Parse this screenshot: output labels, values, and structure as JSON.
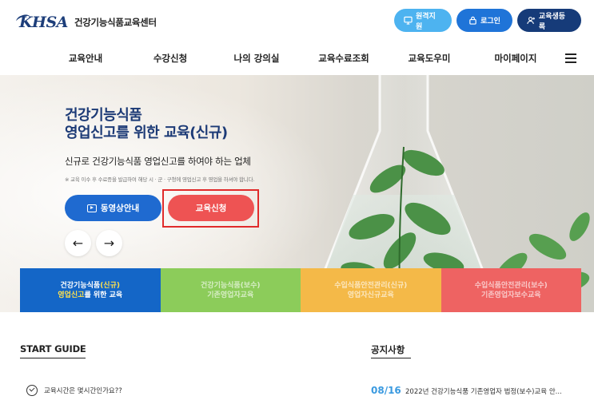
{
  "header": {
    "logo_mark": "KHSA",
    "logo_text": "건강기능식품교육센터",
    "buttons": [
      {
        "label": "원격지원",
        "icon": "monitor-icon"
      },
      {
        "label": "로그인",
        "icon": "lock-icon"
      },
      {
        "label": "교육생등록",
        "icon": "user-add-icon"
      }
    ]
  },
  "nav": {
    "items": [
      "교육안내",
      "수강신청",
      "나의 강의실",
      "교육수료조회",
      "교육도우미",
      "마이페이지"
    ],
    "menu_icon": "hamburger-icon"
  },
  "hero": {
    "title_line1": "건강기능식품",
    "title_line2": "영업신고를 위한 교육(신규)",
    "subtitle": "신규로 건강기능식품 영업신고를 하여야 하는 업체",
    "note": "※ 교육 이수 후 수료증을 발급하여 해당 시 · 군 · 구청에 영업신고 후 영업을 하셔야 합니다.",
    "video_button": "동영상안내",
    "apply_button": "교육신청",
    "prev_arrow": "←",
    "next_arrow": "→"
  },
  "tabs": [
    {
      "line1_pre": "건강기능식품",
      "line1_hl": "(신규)",
      "line2_hl": "영업신고",
      "line2_post": "를 위한 교육"
    },
    {
      "line1": "건강기능식품(보수)",
      "line2": "기존영업자교육"
    },
    {
      "line1": "수입식품안전관리(신규)",
      "line2": "영업자신규교육"
    },
    {
      "line1": "수입식품안전관리(보수)",
      "line2": "기존영업자보수교육"
    }
  ],
  "start_guide": {
    "title": "START GUIDE",
    "item": "교육시간은 몇시간인가요??"
  },
  "notice": {
    "title": "공지사항",
    "date": "08/16",
    "text": "2022년 건강기능식품 기존영업자 법정(보수)교육 안..."
  },
  "colors": {
    "primary_navy": "#1c3a76",
    "tab_blue": "#1466c7",
    "tab_green": "#8ccc5a",
    "tab_yellow": "#f4b948",
    "tab_red": "#ee6362",
    "apply_red": "#ee5353",
    "highlight_frame": "#e02b2b",
    "notice_date": "#3a9ae0"
  }
}
